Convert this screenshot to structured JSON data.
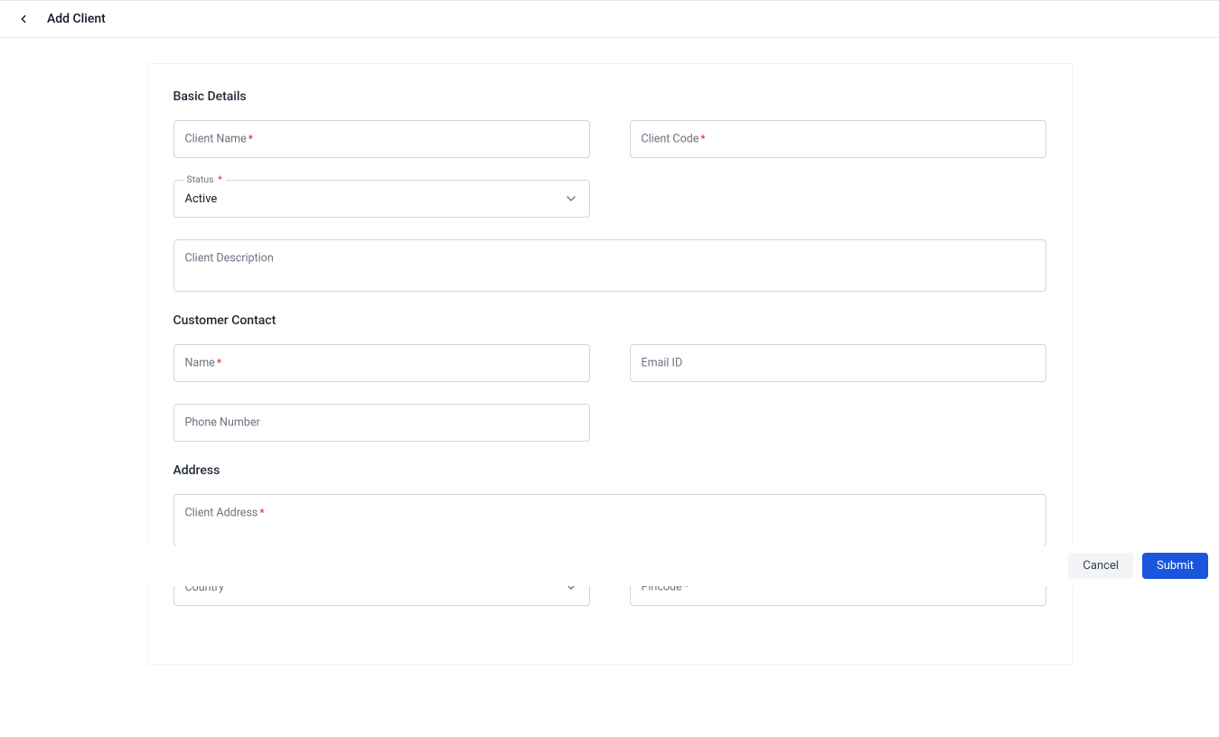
{
  "header": {
    "title": "Add Client"
  },
  "sections": {
    "basic": {
      "title": "Basic Details",
      "client_name_label": "Client Name",
      "client_code_label": "Client Code",
      "status_label": "Status",
      "status_value": "Active",
      "client_description_label": "Client Description"
    },
    "contact": {
      "title": "Customer Contact",
      "name_label": "Name",
      "email_label": "Email ID",
      "phone_label": "Phone Number"
    },
    "address": {
      "title": "Address",
      "client_address_label": "Client Address",
      "country_label": "Country",
      "pincode_label": "Pincode"
    }
  },
  "footer": {
    "cancel_label": "Cancel",
    "submit_label": "Submit"
  }
}
